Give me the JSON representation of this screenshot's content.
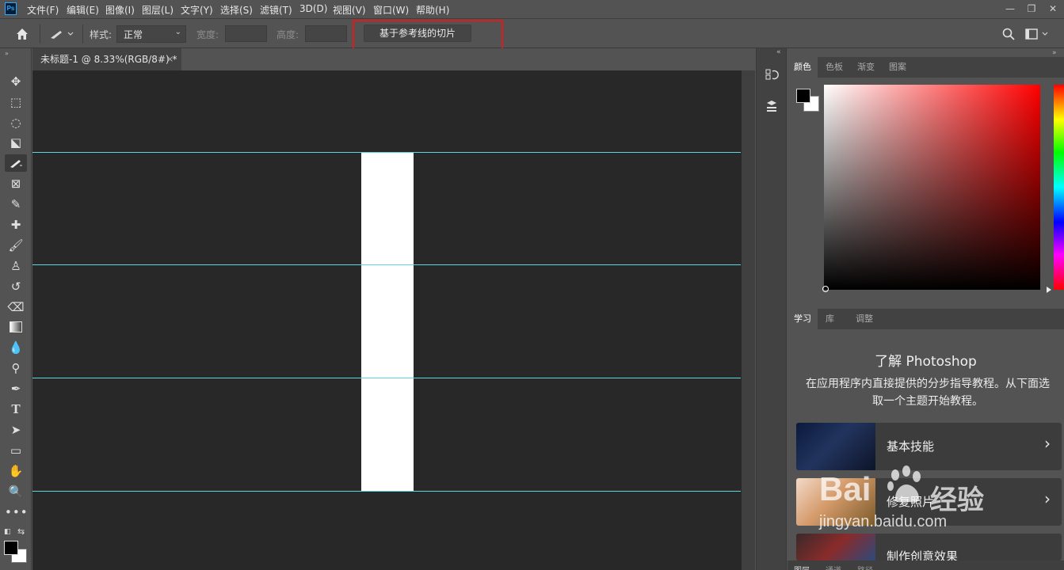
{
  "app": {
    "logo": "Ps"
  },
  "menu": [
    "文件(F)",
    "编辑(E)",
    "图像(I)",
    "图层(L)",
    "文字(Y)",
    "选择(S)",
    "滤镜(T)",
    "3D(D)",
    "视图(V)",
    "窗口(W)",
    "帮助(H)"
  ],
  "window_controls": {
    "minimize": "—",
    "restore": "❐",
    "close": "✕"
  },
  "options": {
    "style_label": "样式:",
    "style_value": "正常",
    "width_label": "宽度:",
    "height_label": "高度:",
    "slice_button": "基于参考线的切片"
  },
  "document": {
    "tab_title": "未标题-1 @ 8.33%(RGB/8#) *",
    "close": "×"
  },
  "tools": [
    "move-icon",
    "marquee-icon",
    "lasso-icon",
    "object-select-icon",
    "slice-icon",
    "frame-icon",
    "eyedropper-icon",
    "healing-icon",
    "brush-icon",
    "stamp-icon",
    "history-brush-icon",
    "eraser-icon",
    "gradient-icon",
    "blur-icon",
    "dodge-icon",
    "pen-icon",
    "type-icon",
    "path-select-icon",
    "rectangle-icon",
    "hand-icon",
    "zoom-icon",
    "more-icon"
  ],
  "panels": {
    "color_tabs": [
      "颜色",
      "色板",
      "渐变",
      "图案"
    ],
    "learn_tabs": [
      "学习",
      "库",
      "调整"
    ],
    "learn_title": "了解 Photoshop",
    "learn_desc": "在应用程序内直接提供的分步指导教程。从下面选取一个主题开始教程。",
    "cards": [
      "基本技能",
      "修复照片",
      "制作创意效果"
    ],
    "bottom_tabs": [
      "图层",
      "通道",
      "路径"
    ]
  },
  "colors": {
    "foreground": "#000000",
    "background": "#ffffff",
    "guide": "#5fd6df",
    "highlight": "#e0191b"
  },
  "watermark": {
    "brand": "Bai",
    "suffix": "经验",
    "url": "jingyan.baidu.com"
  }
}
